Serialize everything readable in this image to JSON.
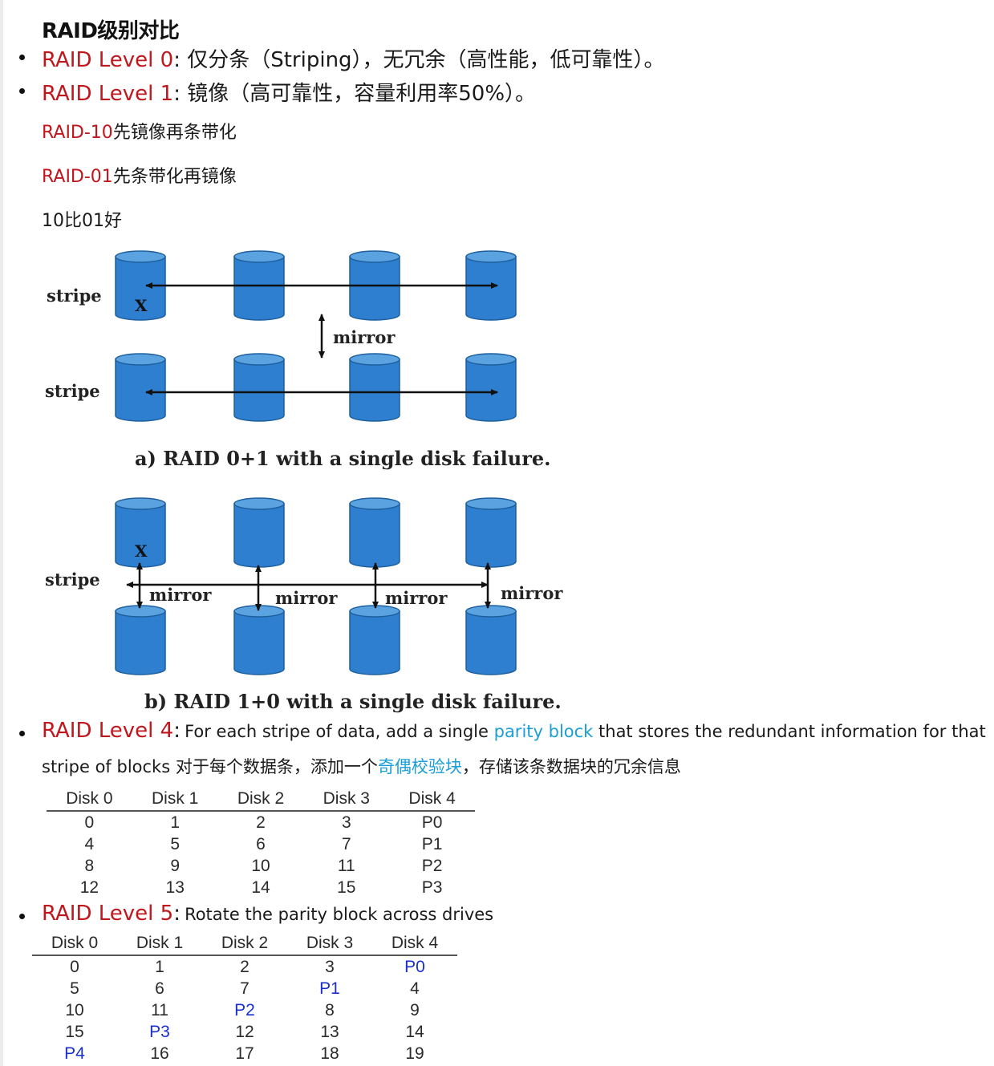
{
  "title": "RAID级别对比",
  "levels": {
    "l0": {
      "label": "RAID Level 0",
      "colon": ":",
      "desc": "仅分条（Striping），无冗余（高性能，低可靠性）。"
    },
    "l1": {
      "label": "RAID Level 1",
      "colon": ":",
      "desc": "镜像（高可靠性，容量利用率50%）。"
    },
    "l4": {
      "label": "RAID Level 4",
      "colon": ":",
      "desc_pre": "For each stripe of data, add a single ",
      "desc_link": "parity block",
      "desc_post": " that stores the redundant information for that",
      "line2_pre": "stripe of blocks  对于每个数据条，添加一个",
      "line2_link": "奇偶校验块",
      "line2_post": "，存储该条数据块的冗余信息"
    },
    "l5": {
      "label": "RAID Level 5",
      "colon": ":",
      "desc": "Rotate the parity block across drives"
    }
  },
  "notes": {
    "n10_label": "RAID-10",
    "n10_text": "先镜像再条带化",
    "n01_label": "RAID-01",
    "n01_text": "先条带化再镜像",
    "compare": "10比01好"
  },
  "figure_a": {
    "row_label_1": "stripe",
    "row_label_2": "stripe",
    "mirror_label": "mirror",
    "fail_mark": "X",
    "caption": "a) RAID 0+1 with a single disk failure."
  },
  "figure_b": {
    "row_label": "stripe",
    "mirror_label": "mirror",
    "fail_mark": "X",
    "caption": "b) RAID 1+0 with a single disk failure."
  },
  "colors": {
    "disk_fill": "#2e7fcf",
    "disk_top": "#5aa3e0",
    "disk_stroke": "#1d5f9c",
    "red": "#c0161c",
    "link_blue": "#1a9fd8",
    "parity_blue": "#1a2fd0"
  },
  "raid4_table": {
    "headers": [
      "Disk 0",
      "Disk 1",
      "Disk 2",
      "Disk 3",
      "Disk 4"
    ],
    "rows": [
      [
        "0",
        "1",
        "2",
        "3",
        "P0"
      ],
      [
        "4",
        "5",
        "6",
        "7",
        "P1"
      ],
      [
        "8",
        "9",
        "10",
        "11",
        "P2"
      ],
      [
        "12",
        "13",
        "14",
        "15",
        "P3"
      ]
    ]
  },
  "raid5_table": {
    "headers": [
      "Disk 0",
      "Disk 1",
      "Disk 2",
      "Disk 3",
      "Disk 4"
    ],
    "rows": [
      [
        "0",
        "1",
        "2",
        "3",
        "P0"
      ],
      [
        "5",
        "6",
        "7",
        "P1",
        "4"
      ],
      [
        "10",
        "11",
        "P2",
        "8",
        "9"
      ],
      [
        "15",
        "P3",
        "12",
        "13",
        "14"
      ],
      [
        "P4",
        "16",
        "17",
        "18",
        "19"
      ]
    ]
  }
}
